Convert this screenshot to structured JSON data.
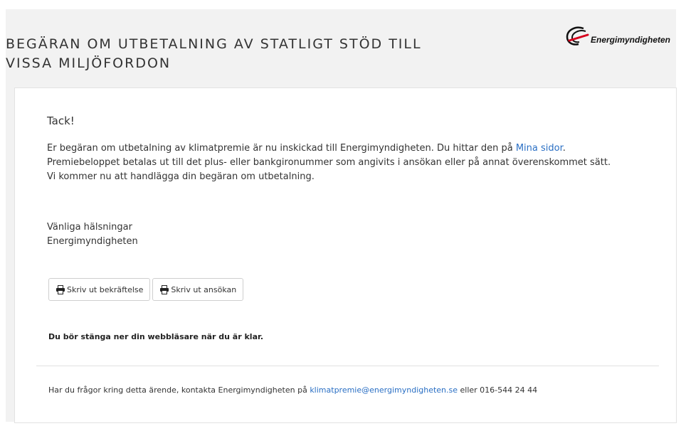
{
  "header": {
    "title_line1": "BEGÄRAN OM UTBETALNING AV STATLIGT STÖD TILL",
    "title_line2": "VISSA MILJÖFORDON",
    "logo_text": "Energimyndigheten"
  },
  "message": {
    "heading": "Tack!",
    "paragraph_line1_before_link": "Er begäran om utbetalning av klimatpremie är nu inskickad till Energimyndigheten. Du hittar den på ",
    "mina_sidor_link": "Mina sidor",
    "paragraph_line1_after_link": ".",
    "paragraph_line2": "Premiebeloppet betalas ut till det plus- eller bankgironummer som angivits i ansökan eller på annat överenskommet sätt.",
    "paragraph_line3": "Vi kommer nu att handlägga din begäran om utbetalning.",
    "greeting": "Vänliga hälsningar",
    "signature": "Energimyndigheten"
  },
  "buttons": {
    "print_confirmation": "Skriv ut bekräftelse",
    "print_application": "Skriv ut ansökan"
  },
  "notice": "Du bör stänga ner din webbläsare när du är klar.",
  "footer": {
    "before_email": "Har du frågor kring detta ärende, kontakta Energimyndigheten på ",
    "email": "klimatpremie@energimyndigheten.se",
    "after_email": " eller 016-544 24 44"
  },
  "colors": {
    "link": "#2a6fc4",
    "logo_red": "#d6001c"
  }
}
